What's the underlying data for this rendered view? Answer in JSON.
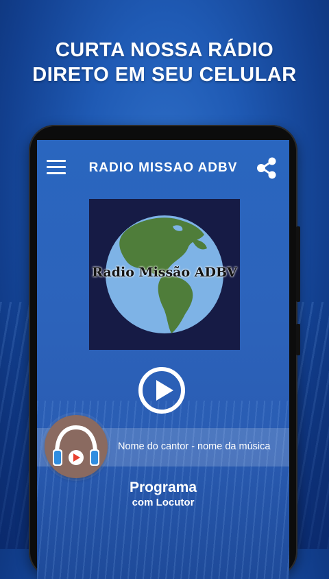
{
  "promo": {
    "line1": "CURTA NOSSA RÁDIO",
    "line2": "DIRETO EM SEU CELULAR"
  },
  "appbar": {
    "title": "RADIO MISSAO ADBV",
    "menu_icon": "hamburger-menu-icon",
    "share_icon": "share-icon"
  },
  "artwork": {
    "title": "Radio Missão ADBV",
    "image": "globe"
  },
  "player": {
    "play_icon": "play-icon",
    "now_playing": "Nome do cantor - nome da música",
    "cover_icon": "headphones-icon",
    "program": "Programa",
    "host": "com Locutor"
  },
  "colors": {
    "accent_blue": "#2a66bf",
    "cover_bg": "#8a6a60",
    "globe_ocean": "#7eb3e6",
    "globe_land": "#4f7d3a"
  }
}
